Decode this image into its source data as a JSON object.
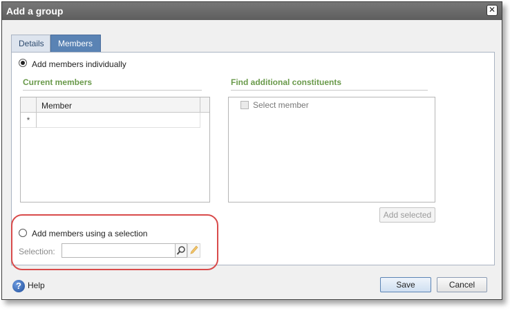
{
  "window": {
    "title": "Add a group"
  },
  "tabs": [
    {
      "label": "Details",
      "active": false
    },
    {
      "label": "Members",
      "active": true
    }
  ],
  "members_tab": {
    "individual_option_label": "Add members individually",
    "individual_selected": true,
    "current_members": {
      "heading": "Current members",
      "columns": [
        "Member"
      ],
      "new_row_marker": "*"
    },
    "find_constituents": {
      "heading": "Find additional constituents",
      "select_member_label": "Select member"
    },
    "add_selected_label": "Add selected",
    "selection_option_label": "Add members using a selection",
    "selection_selected": false,
    "selection_field_label": "Selection:",
    "selection_value": ""
  },
  "footer": {
    "help_label": "Help",
    "save_label": "Save",
    "cancel_label": "Cancel"
  },
  "colors": {
    "section_heading": "#6a9a4b",
    "active_tab": "#5a83b4",
    "highlight_outline": "#d84a4a"
  }
}
